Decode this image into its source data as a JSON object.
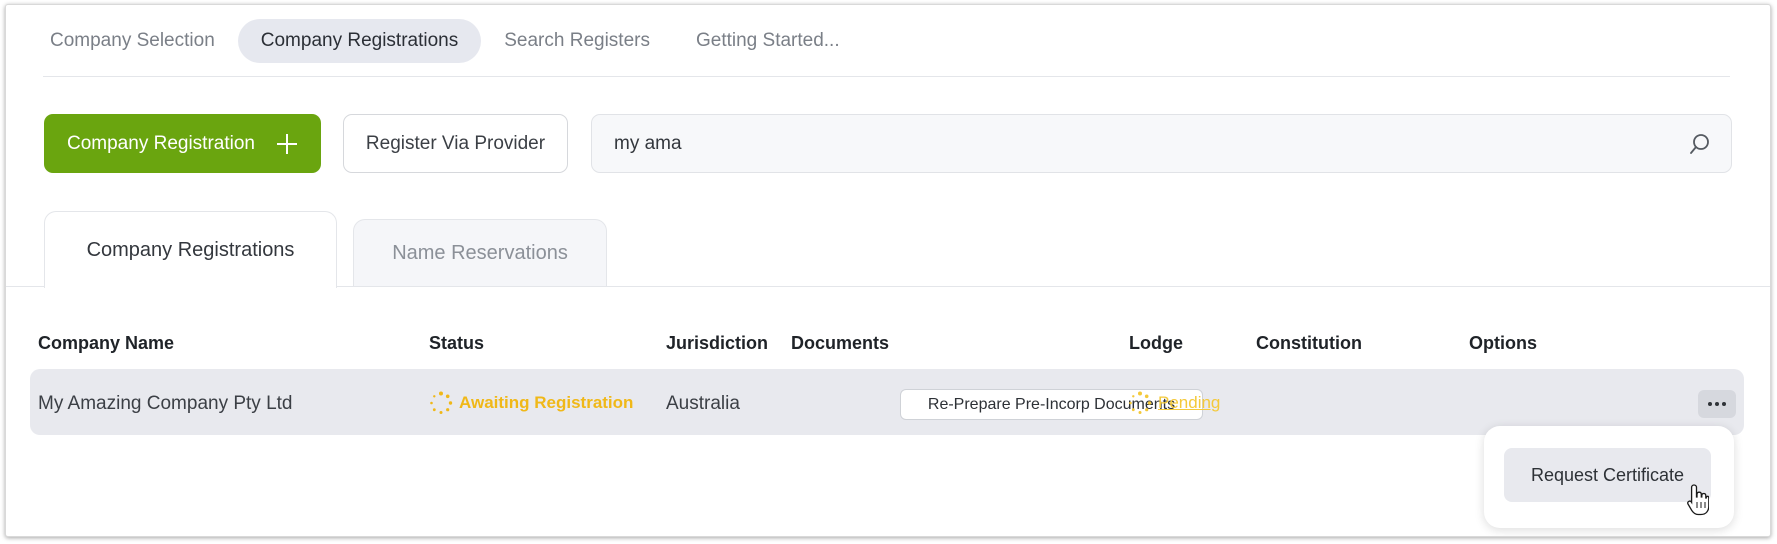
{
  "topnav": {
    "items": [
      {
        "label": "Company Selection",
        "active": false
      },
      {
        "label": "Company Registrations",
        "active": true
      },
      {
        "label": "Search Registers",
        "active": false
      },
      {
        "label": "Getting Started...",
        "active": false
      }
    ]
  },
  "actions": {
    "primary_label": "Company Registration",
    "secondary_label": "Register Via Provider",
    "search_value": "my ama"
  },
  "tabs": {
    "active_label": "Company Registrations",
    "inactive_label": "Name Reservations"
  },
  "table": {
    "headers": {
      "company_name": "Company Name",
      "status": "Status",
      "jurisdiction": "Jurisdiction",
      "documents": "Documents",
      "lodge": "Lodge",
      "constitution": "Constitution",
      "options": "Options"
    },
    "rows": [
      {
        "company_name": "My Amazing Company Pty Ltd",
        "status": "Awaiting Registration",
        "jurisdiction": "Australia",
        "documents": "Re-Prepare Pre-Incorp Documents",
        "lodge": "Pending",
        "constitution": ""
      }
    ]
  },
  "dropdown": {
    "item_label": "Request Certificate"
  },
  "colors": {
    "primary": "#6aa50f",
    "status_pending": "#f0b818",
    "row_bg": "#e8e9ee"
  }
}
